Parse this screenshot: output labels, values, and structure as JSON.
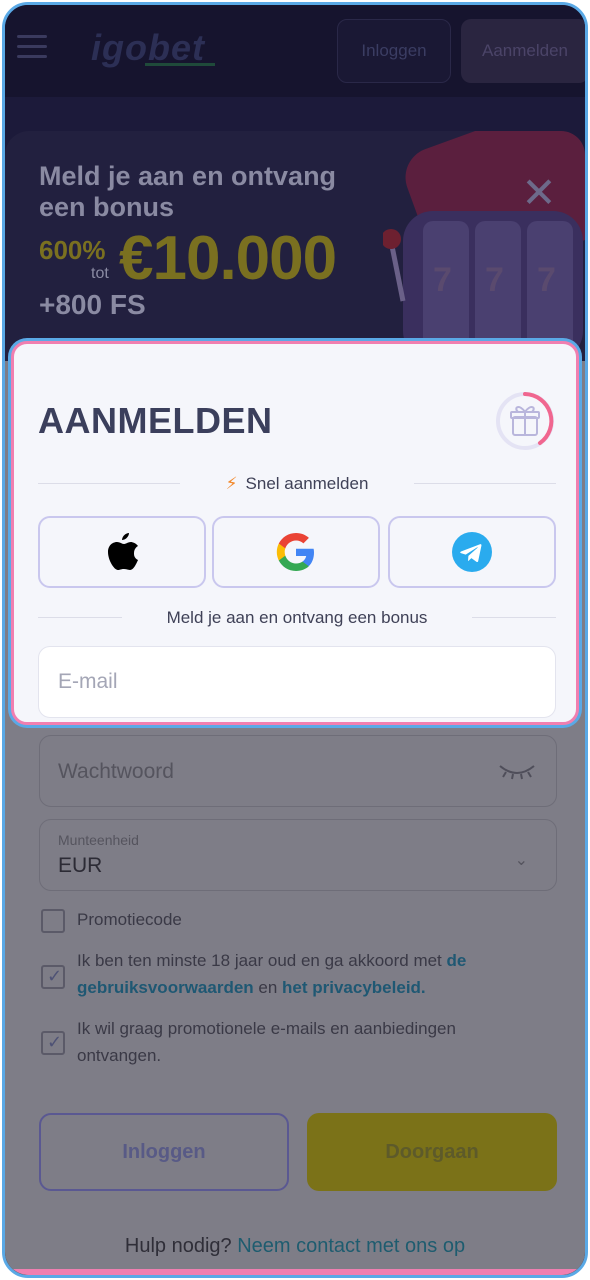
{
  "header": {
    "logo": "igobet",
    "login_label": "Inloggen",
    "signup_label": "Aanmelden"
  },
  "banner": {
    "title": "Meld je aan en ontvang een bonus",
    "percent": "600%",
    "up_to": "tot",
    "amount": "€10.000",
    "free_spins": "+800 FS",
    "close_icon": "close-icon"
  },
  "signup": {
    "title": "AANMELDEN",
    "gift_icon": "gift-icon",
    "quick_label": "Snel aanmelden",
    "social": [
      {
        "name": "apple",
        "icon": "apple-icon"
      },
      {
        "name": "google",
        "icon": "google-icon"
      },
      {
        "name": "telegram",
        "icon": "telegram-icon"
      }
    ],
    "bonus_label": "Meld je aan en ontvang een bonus",
    "email_placeholder": "E-mail",
    "email_value": ""
  },
  "form": {
    "password_placeholder": "Wachtwoord",
    "currency_label": "Munteenheid",
    "currency_value": "EUR",
    "promo_label": "Promotiecode",
    "promo_checked": false,
    "terms": {
      "text_before": "Ik ben ten minste 18 jaar oud en ga akkoord met ",
      "link1": "de gebruiksvoorwaarden",
      "text_mid": " en ",
      "link2": "het privacybeleid.",
      "checked": true
    },
    "marketing_label": "Ik wil graag promotionele e-mails en aanbiedingen ontvangen.",
    "marketing_checked": true,
    "login_button": "Inloggen",
    "continue_button": "Doorgaan",
    "help_text": "Hulp nodig?",
    "help_link": "Neem contact met ons op"
  },
  "colors": {
    "accent_pink": "#f07fb0",
    "accent_blue": "#5aa9e6",
    "google_blue": "#4285f4",
    "telegram_blue": "#2aabee",
    "bolt_orange": "#f28a2e"
  }
}
